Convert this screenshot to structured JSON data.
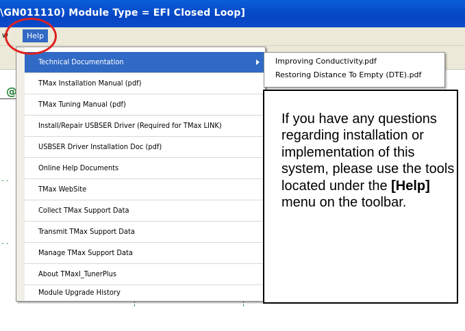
{
  "window": {
    "title": "\\GN011110) Module Type = EFI Closed Loop]"
  },
  "menubar": {
    "partial_item": "w",
    "help_label": "Help"
  },
  "help_menu": {
    "items": [
      {
        "label": "Technical Documentation",
        "has_submenu": true,
        "selected": true
      },
      {
        "label": "TMax Installation Manual (pdf)"
      },
      {
        "label": "TMax Tuning Manual (pdf)"
      },
      {
        "label": "Install/Repair USBSER Driver (Required for TMax LINK)"
      },
      {
        "label": " USBSER Driver Installation Doc (pdf)"
      },
      {
        "label": "Online Help Documents"
      },
      {
        "label": "TMax WebSite"
      },
      {
        "label": "Collect TMax Support Data"
      },
      {
        "label": "Transmit TMax Support Data"
      },
      {
        "label": "Manage TMax Support Data"
      },
      {
        "label": "About TMaxI_TunerPlus"
      },
      {
        "label": "Module Upgrade History"
      }
    ]
  },
  "submenu": {
    "items": [
      {
        "label": "Improving Conductivity.pdf"
      },
      {
        "label": "Restoring Distance To Empty (DTE).pdf"
      }
    ]
  },
  "callout": {
    "text_before": "If you have any questions regarding installation or implementation of this system, please use the tools located under the ",
    "bold_text": "[Help]",
    "text_after": " menu on the toolbar."
  },
  "background": {
    "at_symbol": "@"
  },
  "colors": {
    "titlebar": "#0545c4",
    "menu_highlight": "#316ac5",
    "annotation_circle": "#e02020",
    "chart_green": "#1a7a2a"
  }
}
